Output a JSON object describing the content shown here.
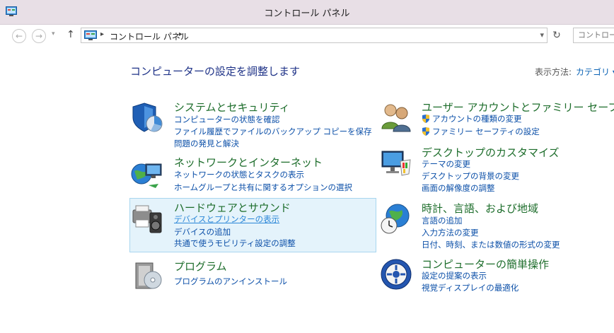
{
  "window": {
    "title": "コントロール パネル"
  },
  "nav": {
    "back": "←",
    "forward": "→",
    "up": "↑",
    "dropdown": "▾",
    "refresh": "↻"
  },
  "address": {
    "path": "コントロール パネル",
    "sep": "▸",
    "dropdown": "▾"
  },
  "search": {
    "placeholder": "コントロール"
  },
  "header": {
    "title": "コンピューターの設定を調整します",
    "view_label": "表示方法:",
    "view_value": "カテゴリ ▾"
  },
  "categories": {
    "system": {
      "title": "システムとセキュリティ",
      "links": [
        "コンピューターの状態を確認",
        "ファイル履歴でファイルのバックアップ コピーを保存",
        "問題の発見と解決"
      ]
    },
    "network": {
      "title": "ネットワークとインターネット",
      "links": [
        "ネットワークの状態とタスクの表示",
        "ホームグループと共有に関するオプションの選択"
      ]
    },
    "hardware": {
      "title": "ハードウェアとサウンド",
      "links": [
        "デバイスとプリンターの表示",
        "デバイスの追加",
        "共通で使うモビリティ設定の調整"
      ]
    },
    "programs": {
      "title": "プログラム",
      "links": [
        "プログラムのアンインストール"
      ]
    },
    "users": {
      "title": "ユーザー アカウントとファミリー セーフティ",
      "links": [
        "アカウントの種類の変更",
        "ファミリー セーフティの設定"
      ]
    },
    "appearance": {
      "title": "デスクトップのカスタマイズ",
      "links": [
        "テーマの変更",
        "デスクトップの背景の変更",
        "画面の解像度の調整"
      ]
    },
    "clock": {
      "title": "時計、言語、および地域",
      "links": [
        "言語の追加",
        "入力方法の変更",
        "日付、時刻、または数値の形式の変更"
      ]
    },
    "ease": {
      "title": "コンピューターの簡単操作",
      "links": [
        "設定の提案の表示",
        "視覚ディスプレイの最適化"
      ]
    }
  },
  "colors": {
    "titlebar": "#e8dfe6",
    "link": "#0b4fa8",
    "category_title": "#1d6d2b",
    "heading": "#1e3287",
    "highlight": "#e4f3fb"
  }
}
